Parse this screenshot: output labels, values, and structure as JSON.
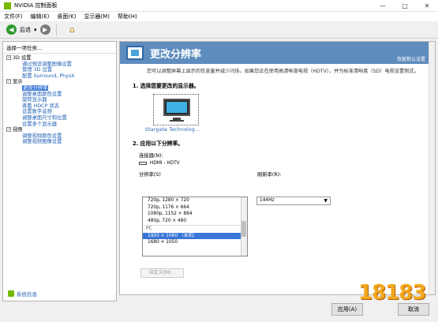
{
  "window": {
    "title": "NVIDIA 控制面板",
    "min": "—",
    "max": "□",
    "close": "✕"
  },
  "menu": [
    "文件(F)",
    "编辑(E)",
    "桌面(K)",
    "显示器(M)",
    "帮助(H)"
  ],
  "toolbar": {
    "back_label": "后退"
  },
  "sidebar": {
    "title": "选择一项任务...",
    "groups": [
      {
        "label": "3D 设置",
        "items": [
          "通过预览调整图像设置",
          "管理 3D 设置",
          "配置 Surround, PhysX"
        ]
      },
      {
        "label": "显示",
        "items": [
          "更改分辨率",
          "调整桌面颜色设置",
          "旋转显示器",
          "查看 HDCP 状态",
          "设置数字音频",
          "调整桌面尺寸和位置",
          "设置多个显示器"
        ]
      },
      {
        "label": "视频",
        "items": [
          "调整视频颜色设置",
          "调整视频图像设置"
        ]
      }
    ],
    "footer_link": "系统信息"
  },
  "main": {
    "title": "更改分辨率",
    "restore_defaults": "恢复默认设置",
    "description": "您可以调整屏幕上显示的信息量并减少闪烁。如果您正在使用高清晰度电视（HDTV），并为标准清晰度（SD）电视设置制式。",
    "step1": "1.  选择您要更改的显示器。",
    "monitor_label": "Stargate Technolog...",
    "step2": "2.  应用以下分辨率。",
    "connector_label": "连接器(N):",
    "connector_value": "HDMI - HDTV",
    "resolution_label": "分辨率(S)",
    "refresh_label": "刷新率(R):",
    "refresh_value": "144Hz",
    "resolutions": [
      "720p, 1280 × 720",
      "720p, 1176 × 664",
      "1080p, 1152 × 864",
      "480p, 720 × 480"
    ],
    "pc_group": "PC",
    "pc_resolutions": [
      "1920 × 1080 （本机）",
      "1680 × 1050"
    ],
    "custom_button": "自定义(M)..."
  },
  "buttons": {
    "apply": "应用(A)",
    "cancel": "取消"
  },
  "watermark": "18183",
  "colors": {
    "nvidia_green": "#76b900",
    "header_blue": "#5e8cbd",
    "selection": "#3875d7",
    "link": "#1e5fb4"
  }
}
